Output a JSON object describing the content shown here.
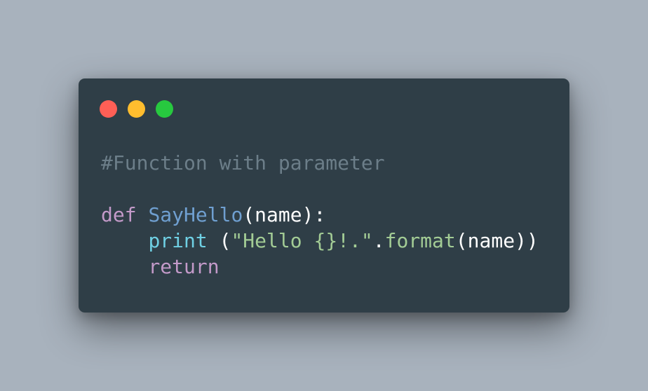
{
  "window": {
    "controls": [
      {
        "name": "close",
        "color": "#ff5f56"
      },
      {
        "name": "minimize",
        "color": "#ffbd2e"
      },
      {
        "name": "maximize",
        "color": "#27c93f"
      }
    ]
  },
  "code": {
    "comment": "#Function with parameter",
    "line2": {
      "keyword": "def",
      "space": " ",
      "function_name": "SayHello",
      "paren_open": "(",
      "param": "name",
      "paren_close_colon": "):"
    },
    "line3": {
      "indent": "    ",
      "builtin": "print",
      "space_paren": " (",
      "string": "\"Hello {}!.\"",
      "dot": ".",
      "method": "format",
      "paren_open": "(",
      "arg": "name",
      "paren_close": "))"
    },
    "line4": {
      "indent": "    ",
      "keyword": "return"
    }
  },
  "colors": {
    "background": "#a8b2bd",
    "window": "#2f3e47",
    "comment": "#6c7e89",
    "keyword": "#c39ac9",
    "function_name": "#6f9fd0",
    "builtin": "#6fd0e4",
    "string": "#a3cc95",
    "method": "#a3cc95",
    "plain": "#ffffff"
  }
}
